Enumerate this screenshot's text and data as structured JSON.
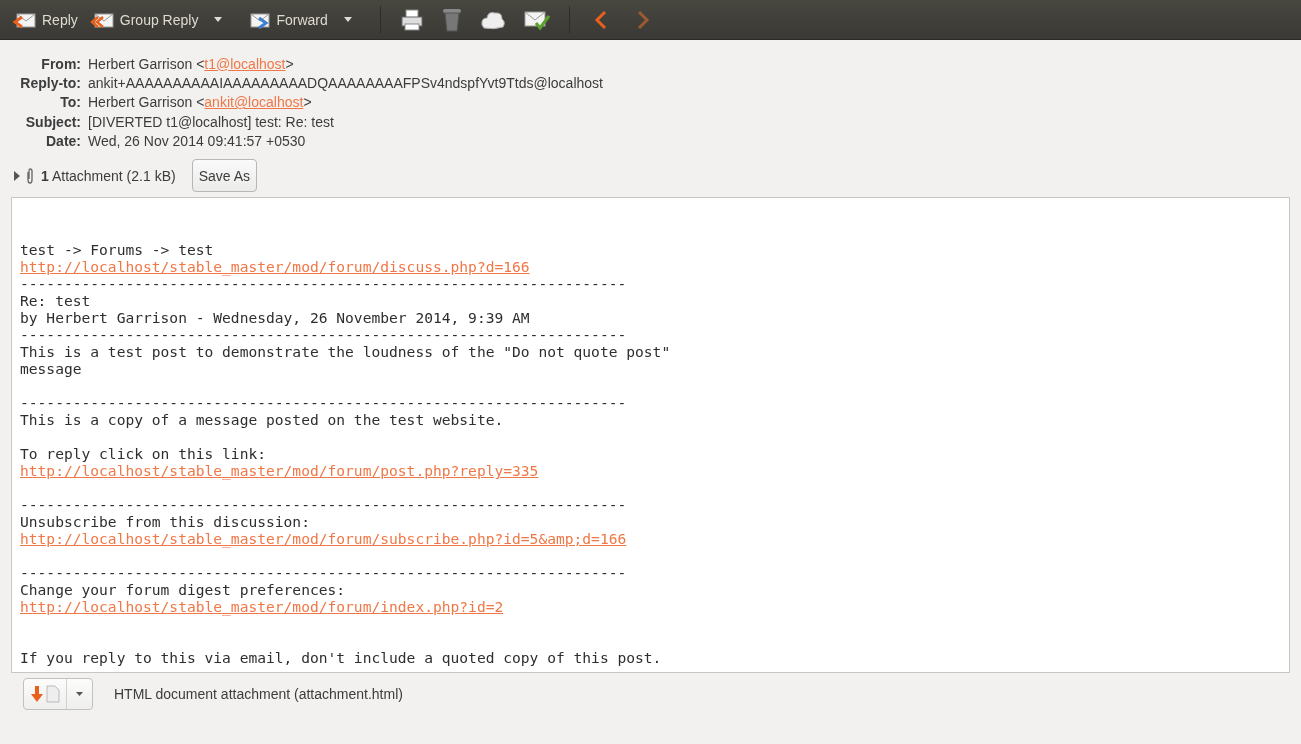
{
  "toolbar": {
    "buttons": [
      {
        "kind": "reply",
        "label": "Reply"
      },
      {
        "kind": "group-reply",
        "label": "Group Reply",
        "dropdown": true
      },
      {
        "kind": "forward",
        "label": "Forward",
        "dropdown": true
      }
    ],
    "icons": [
      {
        "kind": "print"
      },
      {
        "kind": "trash"
      },
      {
        "kind": "junk"
      },
      {
        "kind": "not-junk"
      },
      {
        "kind": "prev"
      },
      {
        "kind": "next"
      }
    ]
  },
  "headers": [
    {
      "label": "From:",
      "parts": [
        {
          "kind": "text",
          "text": "Herbert Garrison <"
        },
        {
          "kind": "link",
          "text": "t1@localhost"
        },
        {
          "kind": "text",
          "text": ">"
        }
      ]
    },
    {
      "label": "Reply-to:",
      "parts": [
        {
          "kind": "text",
          "text": "ankit+AAAAAAAAAAIAAAAAAAAADQAAAAAAAAFPSv4ndspfYvt9Ttds@localhost"
        }
      ]
    },
    {
      "label": "To:",
      "parts": [
        {
          "kind": "text",
          "text": "Herbert Garrison <"
        },
        {
          "kind": "link",
          "text": "ankit@localhost"
        },
        {
          "kind": "text",
          "text": ">"
        }
      ]
    },
    {
      "label": "Subject:",
      "parts": [
        {
          "kind": "text",
          "text": "[DIVERTED t1@localhost] test: Re: test"
        }
      ]
    },
    {
      "label": "Date:",
      "parts": [
        {
          "kind": "text",
          "text": "Wed, 26 Nov 2014 09:41:57 +0530"
        }
      ]
    }
  ],
  "attachments_bar": {
    "expanded": false,
    "summary": "**1** Attachment (2.1 kB)",
    "save_button": "Save As"
  },
  "body": [
    {
      "kind": "blank"
    },
    {
      "kind": "text",
      "text": "test -> Forums -> test"
    },
    {
      "kind": "link",
      "text": "http://localhost/stable_master/mod/forum/discuss.php?d=166"
    },
    {
      "kind": "text",
      "text": "---------------------------------------------------------------------"
    },
    {
      "kind": "text",
      "text": "Re: test"
    },
    {
      "kind": "text",
      "text": "by Herbert Garrison - Wednesday, 26 November 2014, 9:39 AM"
    },
    {
      "kind": "text",
      "text": "---------------------------------------------------------------------"
    },
    {
      "kind": "text",
      "text": "This is a test post to demonstrate the loudness of the \"Do not quote post\""
    },
    {
      "kind": "text",
      "text": "message"
    },
    {
      "kind": "blank"
    },
    {
      "kind": "text",
      "text": "---------------------------------------------------------------------"
    },
    {
      "kind": "text",
      "text": "This is a copy of a message posted on the test website."
    },
    {
      "kind": "blank"
    },
    {
      "kind": "text",
      "text": "To reply click on this link:"
    },
    {
      "kind": "link",
      "text": "http://localhost/stable_master/mod/forum/post.php?reply=335"
    },
    {
      "kind": "blank"
    },
    {
      "kind": "text",
      "text": "---------------------------------------------------------------------"
    },
    {
      "kind": "text",
      "text": "Unsubscribe from this discussion:"
    },
    {
      "kind": "link",
      "text": "http://localhost/stable_master/mod/forum/subscribe.php?id=5&amp;d=166"
    },
    {
      "kind": "blank"
    },
    {
      "kind": "text",
      "text": "---------------------------------------------------------------------"
    },
    {
      "kind": "text",
      "text": "Change your forum digest preferences:"
    },
    {
      "kind": "link",
      "text": "http://localhost/stable_master/mod/forum/index.php?id=2"
    },
    {
      "kind": "blank"
    },
    {
      "kind": "blank"
    },
    {
      "kind": "text",
      "text": "If you reply to this via email, don't include a quoted copy of this post."
    }
  ],
  "attachment": {
    "label": "HTML document attachment (attachment.html)"
  }
}
